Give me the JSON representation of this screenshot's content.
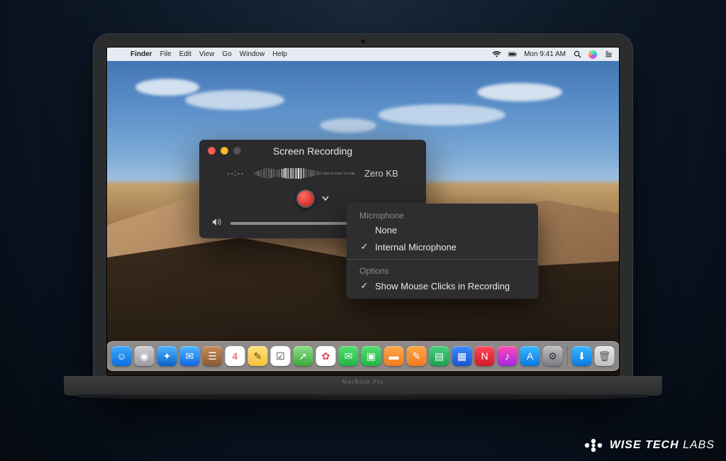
{
  "laptop_label": "MacBook Pro",
  "menubar": {
    "apple": "",
    "app": "Finder",
    "items": [
      "File",
      "Edit",
      "View",
      "Go",
      "Window",
      "Help"
    ],
    "clock": "Mon 9:41 AM"
  },
  "dock": {
    "items": [
      {
        "name": "finder",
        "glyph": "☺",
        "bg": "linear-gradient(#3ea8ff,#0a6fe0)"
      },
      {
        "name": "launchpad",
        "glyph": "◉",
        "bg": "linear-gradient(#d0d0d4,#9a9aa0)"
      },
      {
        "name": "safari",
        "glyph": "✦",
        "bg": "linear-gradient(#4fb5ff,#0a63c9)"
      },
      {
        "name": "mail",
        "glyph": "✉",
        "bg": "linear-gradient(#4fb8ff,#1266e0)"
      },
      {
        "name": "contacts",
        "glyph": "☰",
        "bg": "linear-gradient(#c78a5a,#8a5a32)"
      },
      {
        "name": "calendar",
        "glyph": "4",
        "bg": "#fff",
        "fg": "#e04040"
      },
      {
        "name": "notes",
        "glyph": "✎",
        "bg": "linear-gradient(#ffe37a,#f5c23a)",
        "fg": "#6a4a10"
      },
      {
        "name": "reminders",
        "glyph": "☑",
        "bg": "#fff",
        "fg": "#333"
      },
      {
        "name": "maps",
        "glyph": "➚",
        "bg": "linear-gradient(#8de08a,#3aa83a)"
      },
      {
        "name": "photos",
        "glyph": "✿",
        "bg": "#fff",
        "fg": "#e04860"
      },
      {
        "name": "messages",
        "glyph": "✉",
        "bg": "linear-gradient(#55e070,#1fb545)"
      },
      {
        "name": "facetime",
        "glyph": "▣",
        "bg": "linear-gradient(#55e070,#1fb545)"
      },
      {
        "name": "books",
        "glyph": "▬",
        "bg": "linear-gradient(#ffa84a,#f07a20)"
      },
      {
        "name": "pages",
        "glyph": "✎",
        "bg": "linear-gradient(#ffa84a,#f07a20)"
      },
      {
        "name": "numbers",
        "glyph": "▤",
        "bg": "linear-gradient(#4ad080,#1aa050)"
      },
      {
        "name": "keynote",
        "glyph": "▦",
        "bg": "linear-gradient(#3a8aff,#1a55d0)"
      },
      {
        "name": "news",
        "glyph": "N",
        "bg": "linear-gradient(#ff4a5a,#d01a2a)"
      },
      {
        "name": "itunes",
        "glyph": "♪",
        "bg": "linear-gradient(#ff4ab0,#a02ae0)"
      },
      {
        "name": "appstore",
        "glyph": "A",
        "bg": "linear-gradient(#3ab8ff,#0a78e0)"
      },
      {
        "name": "preferences",
        "glyph": "⚙",
        "bg": "linear-gradient(#c0c0c4,#7a7a80)",
        "fg": "#333"
      }
    ],
    "right": [
      {
        "name": "downloads",
        "glyph": "⬇",
        "bg": "linear-gradient(#3ab8ff,#0a78e0)"
      },
      {
        "name": "trash",
        "glyph": "🗑",
        "bg": "linear-gradient(#e8e8ec,#c0c0c4)",
        "fg": "#555"
      }
    ]
  },
  "panel": {
    "title": "Screen Recording",
    "timecode": "--:--",
    "file_size": "Zero KB"
  },
  "dropdown": {
    "section1_header": "Microphone",
    "item_none": "None",
    "item_internal": "Internal Microphone",
    "section2_header": "Options",
    "item_mouse": "Show Mouse Clicks in Recording",
    "check": "✓"
  },
  "watermark": {
    "brand1": "WISE",
    "brand2": "TECH",
    "brand3": "LABS"
  }
}
